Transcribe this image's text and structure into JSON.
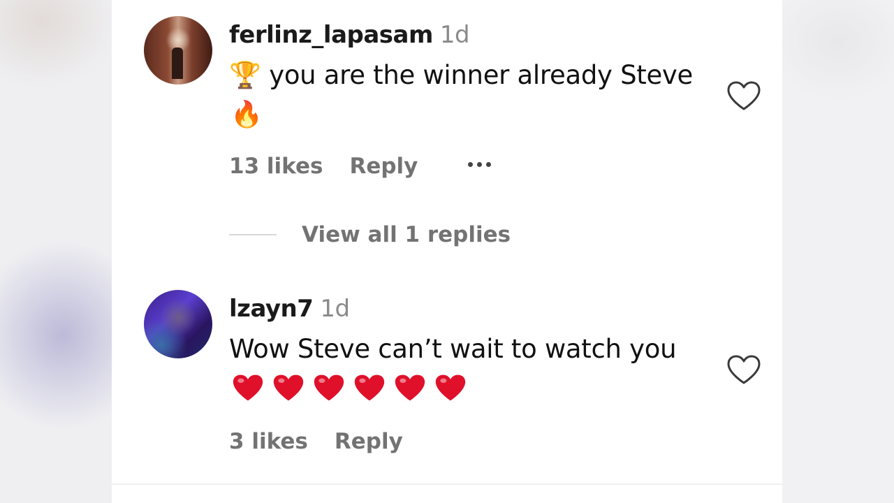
{
  "comments": [
    {
      "username": "ferlinz_lapasam",
      "time": "1d",
      "text_line1": "🏆 you are the winner already Steve",
      "text_line2": "🔥",
      "likes": "13 likes",
      "reply_label": "Reply",
      "avatar_icon": "profile-photo"
    },
    {
      "username": "lzayn7",
      "time": "1d",
      "text_line1": "Wow Steve can’t wait to watch you",
      "hearts_count": 6,
      "likes": "3 likes",
      "reply_label": "Reply",
      "avatar_icon": "profile-photo"
    }
  ],
  "view_replies": "View all 1 replies",
  "icons": {
    "like": "heart-outline-icon",
    "more": "more-dots-icon",
    "heart_emoji": "red-heart-emoji"
  },
  "colors": {
    "panel_bg": "#ffffff",
    "meta_text": "#737373",
    "heart_red": "#e0102a"
  }
}
